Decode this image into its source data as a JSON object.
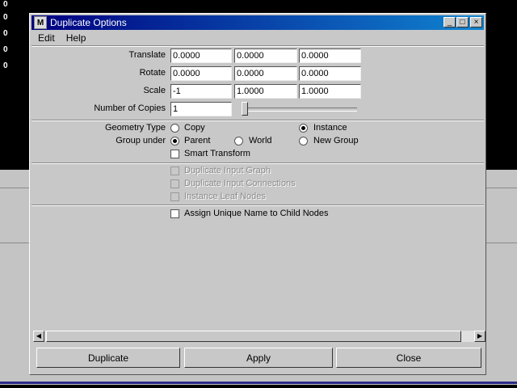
{
  "window": {
    "title": "Duplicate Options"
  },
  "menu": [
    "Edit",
    "Help"
  ],
  "transform": {
    "translate": {
      "label": "Translate",
      "x": "0.0000",
      "y": "0.0000",
      "z": "0.0000"
    },
    "rotate": {
      "label": "Rotate",
      "x": "0.0000",
      "y": "0.0000",
      "z": "0.0000"
    },
    "scale": {
      "label": "Scale",
      "x": "-1",
      "y": "1.0000",
      "z": "1.0000"
    }
  },
  "copies": {
    "label": "Number of Copies",
    "value": "1",
    "slider_fraction": 0.0
  },
  "geometry_type": {
    "label": "Geometry Type",
    "options": [
      "Copy",
      "Instance"
    ],
    "selected": "Instance"
  },
  "group_under": {
    "label": "Group under",
    "options": [
      "Parent",
      "World",
      "New Group"
    ],
    "selected": "Parent"
  },
  "smart_transform": {
    "label": "Smart Transform",
    "checked": false
  },
  "disabled_options": [
    "Duplicate Input Graph",
    "Duplicate Input Connections",
    "Instance Leaf Nodes"
  ],
  "unique_names": {
    "label": "Assign Unique Name to Child Nodes",
    "checked": false
  },
  "buttons": {
    "duplicate": "Duplicate",
    "apply": "Apply",
    "close": "Close"
  },
  "background_numbers": [
    "0",
    "0",
    "0",
    "0",
    "0"
  ]
}
